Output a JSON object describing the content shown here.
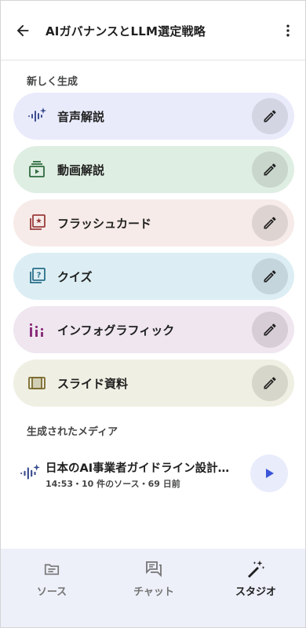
{
  "header": {
    "title": "AIガバナンスとLLM選定戦略"
  },
  "generate_section": {
    "label": "新しく生成",
    "items": [
      {
        "label": "音声解説",
        "icon": "audio-waveform-icon",
        "bg": "#e9ebfb",
        "edit_bg": "#d3d5e2",
        "icon_color": "#3b4d8f"
      },
      {
        "label": "動画解説",
        "icon": "video-icon",
        "bg": "#dfeee2",
        "edit_bg": "#c8d6cb",
        "icon_color": "#2f6b3f"
      },
      {
        "label": "フラッシュカード",
        "icon": "flashcards-icon",
        "bg": "#f6ebe8",
        "edit_bg": "#ddd3d0",
        "icon_color": "#9a3b3b"
      },
      {
        "label": "クイズ",
        "icon": "quiz-icon",
        "bg": "#dceef4",
        "edit_bg": "#c4d5dc",
        "icon_color": "#2b6f8a"
      },
      {
        "label": "インフォグラフィック",
        "icon": "infographic-icon",
        "bg": "#efe6ef",
        "edit_bg": "#d6cdd6",
        "icon_color": "#8a2f7d"
      },
      {
        "label": "スライド資料",
        "icon": "slides-icon",
        "bg": "#efefe3",
        "edit_bg": "#d6d6ca",
        "icon_color": "#7a6a2c"
      }
    ]
  },
  "media_section": {
    "label": "生成されたメディア",
    "items": [
      {
        "title": "日本のAI事業者ガイドライン設計…",
        "meta": "14:53・10 件のソース・69 日前",
        "icon": "audio-waveform-icon"
      }
    ]
  },
  "bottom_nav": {
    "items": [
      {
        "label": "ソース",
        "icon": "sources-icon",
        "active": false
      },
      {
        "label": "チャット",
        "icon": "chat-icon",
        "active": false
      },
      {
        "label": "スタジオ",
        "icon": "studio-wand-icon",
        "active": true
      }
    ]
  },
  "colors": {
    "accent": "#3b56d9",
    "text": "#1f1f1f",
    "muted": "#757575",
    "nav_bg": "#edeff9"
  }
}
